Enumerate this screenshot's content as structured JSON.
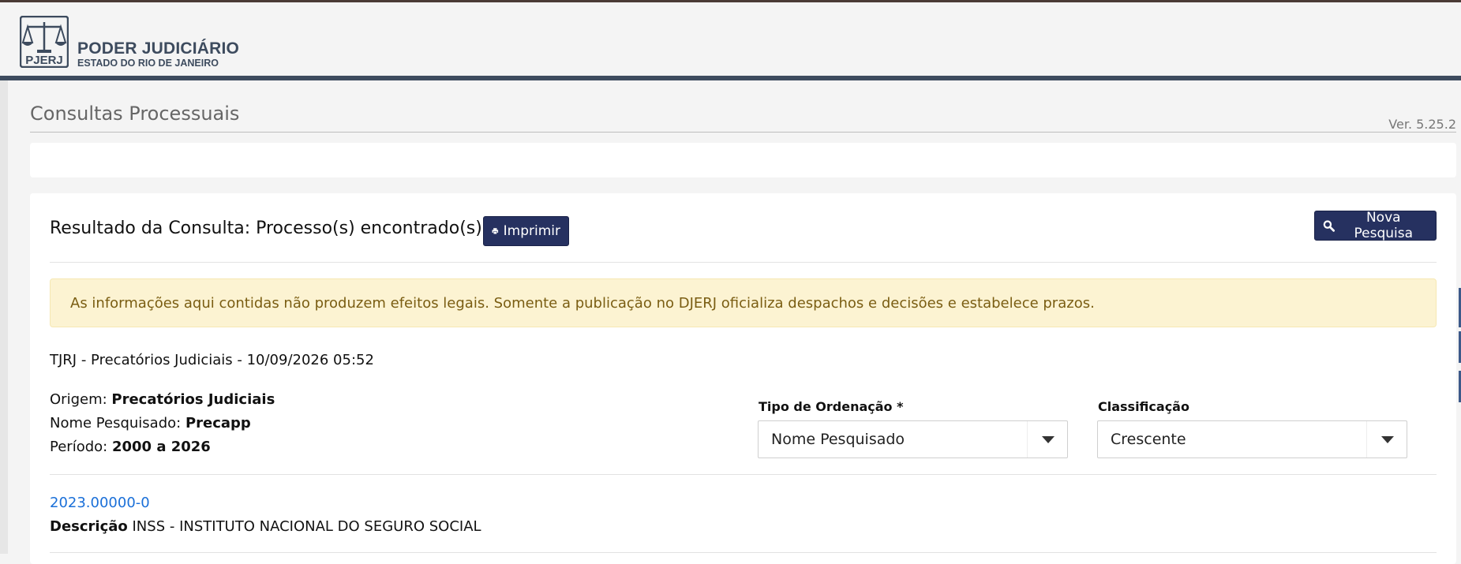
{
  "header": {
    "logo_text": "PJERJ",
    "title": "PODER JUDICIÁRIO",
    "subtitle": "ESTADO DO RIO DE JANEIRO"
  },
  "page": {
    "title": "Consultas Processuais",
    "version": "Ver. 5.25.2"
  },
  "result": {
    "title": "Resultado da Consulta: Processo(s) encontrado(s)",
    "print_label": "Imprimir",
    "new_search_label": "Nova Pesquisa",
    "alert": "As informações aqui contidas não produzem efeitos legais. Somente a publicação no DJERJ oficializa despachos e decisões e estabelece prazos.",
    "source": "TJRJ - Precatórios Judiciais - 10/09/2026 05:52",
    "origem_label": "Origem:",
    "origem_value": "Precatórios Judiciais",
    "nome_label": "Nome Pesquisado:",
    "nome_value": "Precapp",
    "periodo_label": "Período:",
    "periodo_value": "2000 a 2026"
  },
  "filters": {
    "ordenacao_label": "Tipo de Ordenação *",
    "ordenacao_value": "Nome Pesquisado",
    "classificacao_label": "Classificação",
    "classificacao_value": "Crescente"
  },
  "processes": [
    {
      "number": "2023.00000-0",
      "desc_label": "Descrição",
      "desc_value": "INSS - INSTITUTO NACIONAL DO SEGURO SOCIAL"
    }
  ],
  "colors": {
    "brand": "#3d4b5e",
    "button": "#263160",
    "alert_bg": "#fcf3d2",
    "link": "#1a6fd8"
  }
}
